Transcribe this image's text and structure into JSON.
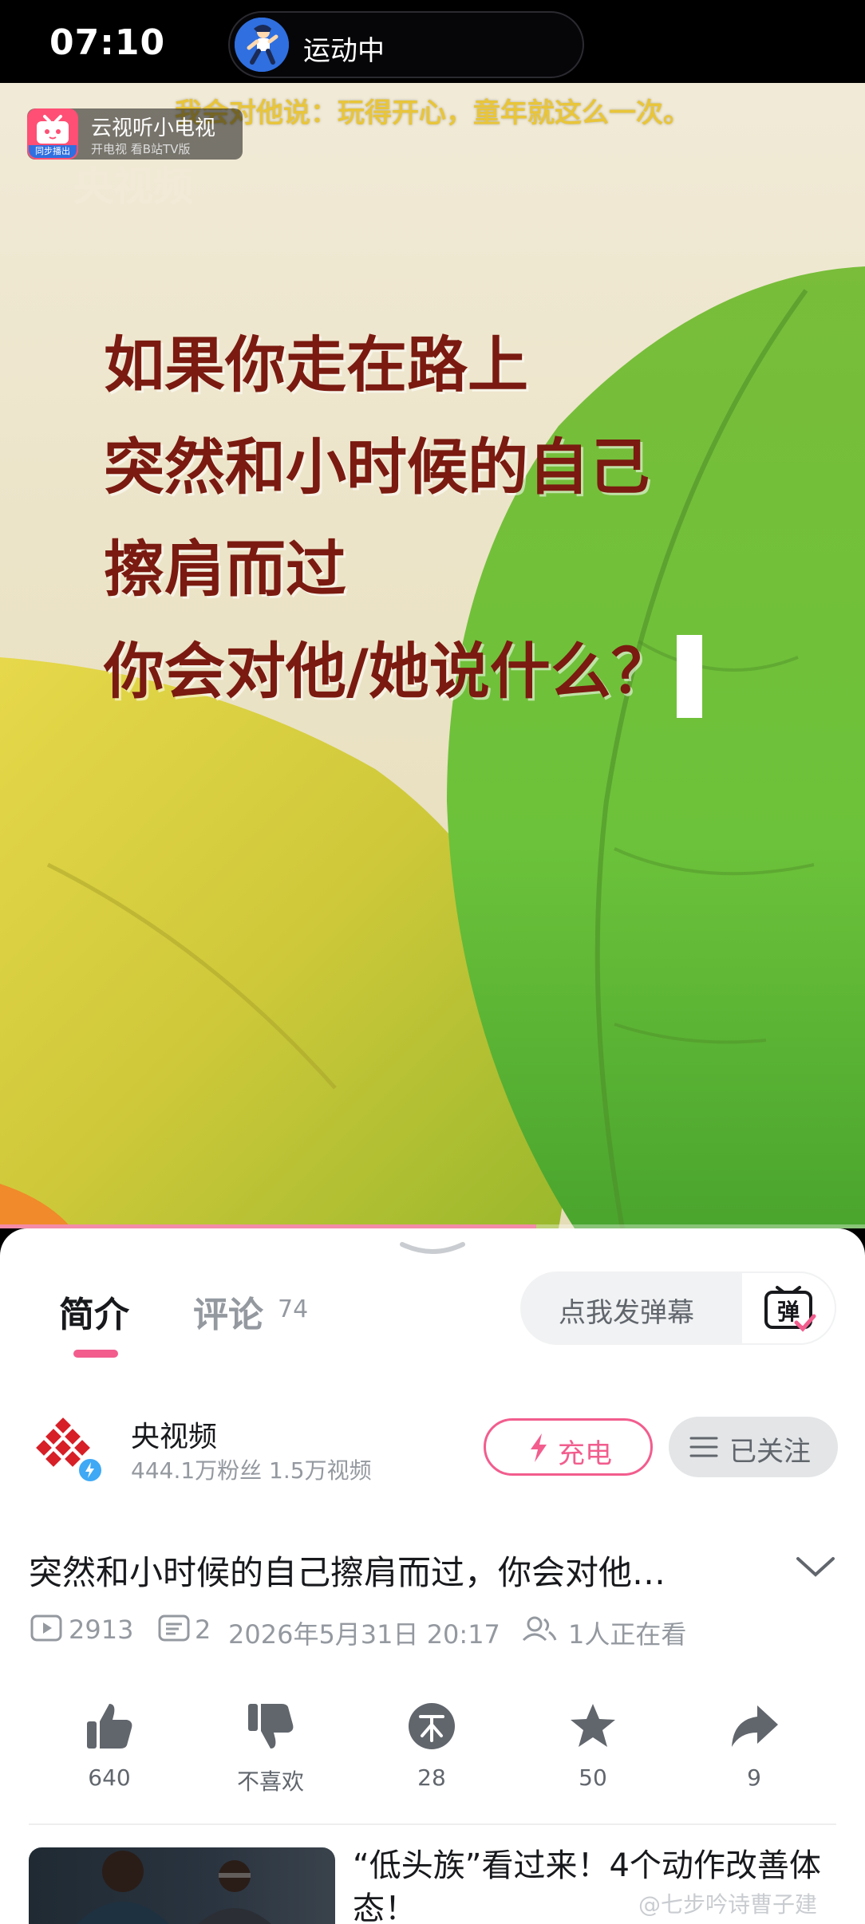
{
  "status_bar": {
    "time": "07:10",
    "activity": "运动中",
    "blurred_text": ""
  },
  "video": {
    "top_subtitle": "我会对他说：玩得开心，童年就这么一次。",
    "app_badge": {
      "name": "云视听小电视",
      "subtitle": "开电视 看B站TV版",
      "sync_label": "同步播出"
    },
    "watermark": "央视频",
    "poem_lines": [
      "如果你走在路上",
      "突然和小时候的自己",
      "擦肩而过",
      "你会对他/她说什么？"
    ],
    "progress": 0.62
  },
  "tabs": {
    "intro": "简介",
    "comments": "评论",
    "comments_count": "74"
  },
  "danmu": {
    "placeholder": "点我发弹幕",
    "icon_char": "弹"
  },
  "uploader": {
    "name": "央视频",
    "stats": "444.1万粉丝  1.5万视频"
  },
  "buttons": {
    "charge": "充电",
    "followed": "已关注"
  },
  "video_info": {
    "title": "突然和小时候的自己擦肩而过，你会对他…",
    "views": "2913",
    "danmaku": "2",
    "date": "2026年5月31日 20:17",
    "watching": "1人正在看"
  },
  "actions": [
    {
      "name": "like",
      "label": "640"
    },
    {
      "name": "dislike",
      "label": "不喜欢"
    },
    {
      "name": "coin",
      "label": "28"
    },
    {
      "name": "favorite",
      "label": "50"
    },
    {
      "name": "share",
      "label": "9"
    }
  ],
  "recommended": {
    "title": "“低头族”看过来！4个动作改善体态！"
  },
  "weibo_watermark": "@七步吟诗曹子建",
  "colors": {
    "accent": "#f25d8e",
    "text": "#18191c",
    "muted": "#9499a0"
  }
}
